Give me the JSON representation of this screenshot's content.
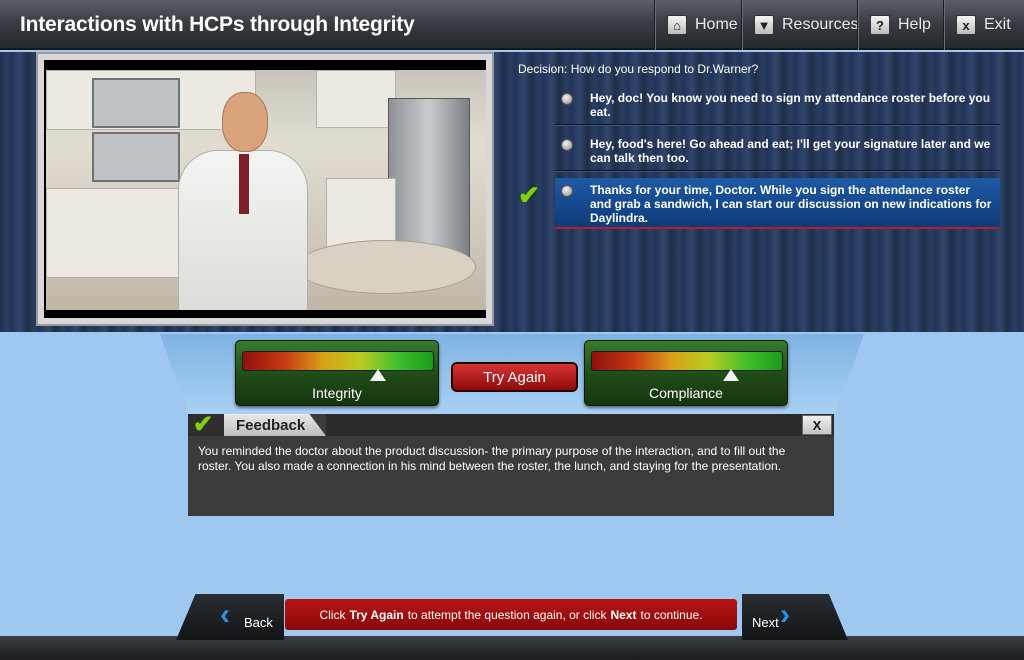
{
  "header": {
    "title": "Interactions with HCPs through Integrity",
    "nav": {
      "home": {
        "label": "Home",
        "icon": "home-icon"
      },
      "resources": {
        "label": "Resources",
        "icon": "download-icon"
      },
      "help": {
        "label": "Help",
        "icon": "help-icon",
        "glyph": "?"
      },
      "exit": {
        "label": "Exit",
        "icon": "close-icon",
        "glyph": "x"
      }
    }
  },
  "decision": {
    "question": "Decision: How do you respond to Dr.Warner?",
    "options": [
      {
        "text": "Hey, doc! You know you need to sign my attendance roster before you eat.",
        "selected": false
      },
      {
        "text": "Hey, food's here! Go ahead and eat; I'll get your signature later and we can talk then too.",
        "selected": false
      },
      {
        "text": "Thanks for your time, Doctor. While you sign the attendance roster and grab a sandwich, I can start our discussion on new indications for Daylindra.",
        "selected": true
      }
    ],
    "check_glyph": "✔"
  },
  "meters": {
    "integrity": {
      "label": "Integrity",
      "level": 0.71
    },
    "compliance": {
      "label": "Compliance",
      "level": 0.73
    }
  },
  "try_again_label": "Try Again",
  "feedback": {
    "title": "Feedback",
    "close_label": "X",
    "text": "You reminded the doctor about the product discussion- the primary purpose of the interaction, and to fill out the roster. You also made a connection in his mind between the roster, the lunch, and staying for the presentation."
  },
  "footer": {
    "back_label": "Back",
    "next_label": "Next",
    "instruction": {
      "part1": "Click",
      "try_again": "Try Again",
      "part2": "to attempt the question again, or click",
      "next": "Next",
      "part3": "to continue."
    }
  },
  "colors": {
    "accent_blue": "#2f8fe0",
    "check_green": "#7fd10f",
    "button_red": "#b71515"
  }
}
